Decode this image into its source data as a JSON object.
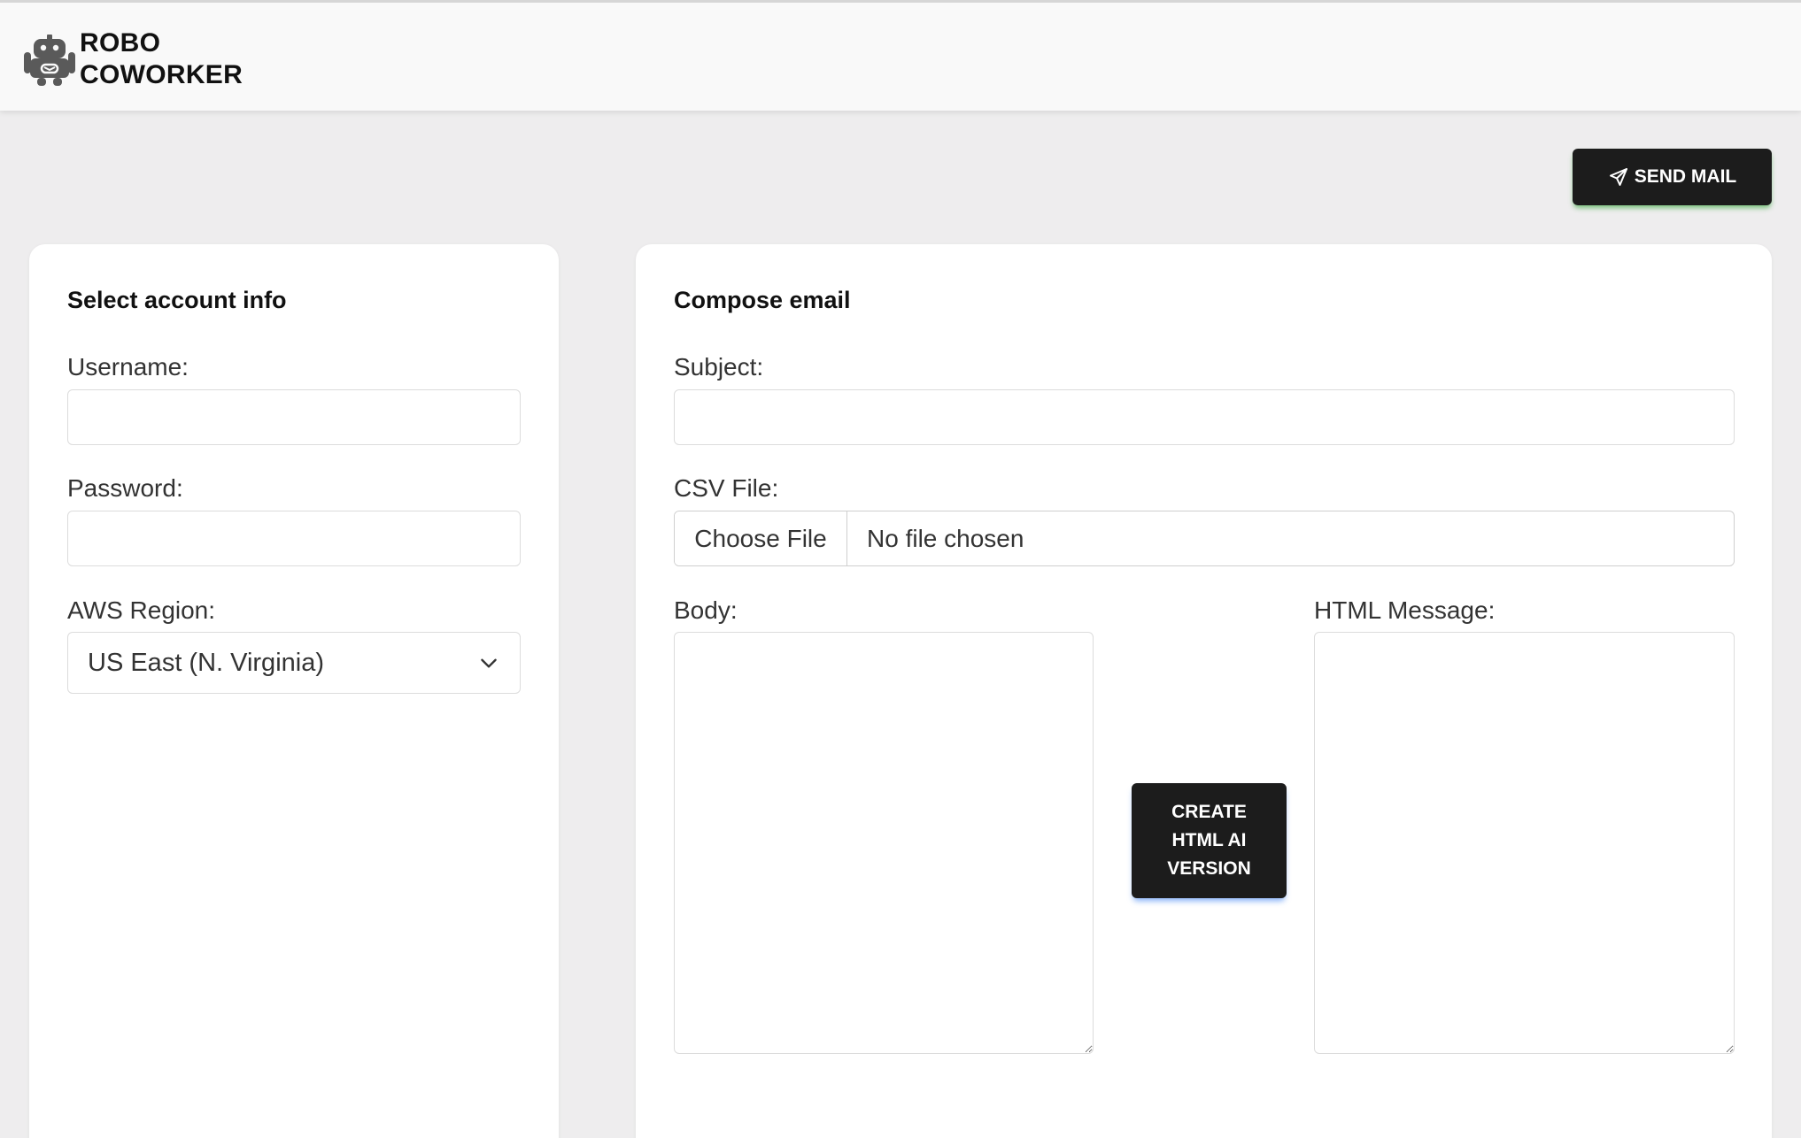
{
  "header": {
    "brand_line1": "ROBO",
    "brand_line2": "COWORKER",
    "logo_icon": "robot-icon"
  },
  "toolbar": {
    "send_label": "SEND MAIL",
    "send_icon": "paper-plane-icon"
  },
  "account": {
    "title": "Select account info",
    "username_label": "Username:",
    "username_value": "",
    "password_label": "Password:",
    "password_value": "",
    "region_label": "AWS Region:",
    "region_selected": "US East (N. Virginia)",
    "region_icon": "chevron-down-icon"
  },
  "compose": {
    "title": "Compose email",
    "subject_label": "Subject:",
    "subject_value": "",
    "csv_label": "CSV File:",
    "file_button": "Choose File",
    "file_status": "No file chosen",
    "body_label": "Body:",
    "body_value": "",
    "html_label": "HTML Message:",
    "html_value": "",
    "ai_button": "CREATE HTML AI VERSION"
  },
  "colors": {
    "page_bg": "#eeedee",
    "button_bg": "#1c1c1c",
    "send_shadow": "#4caf50",
    "ai_shadow": "#4285f4"
  }
}
